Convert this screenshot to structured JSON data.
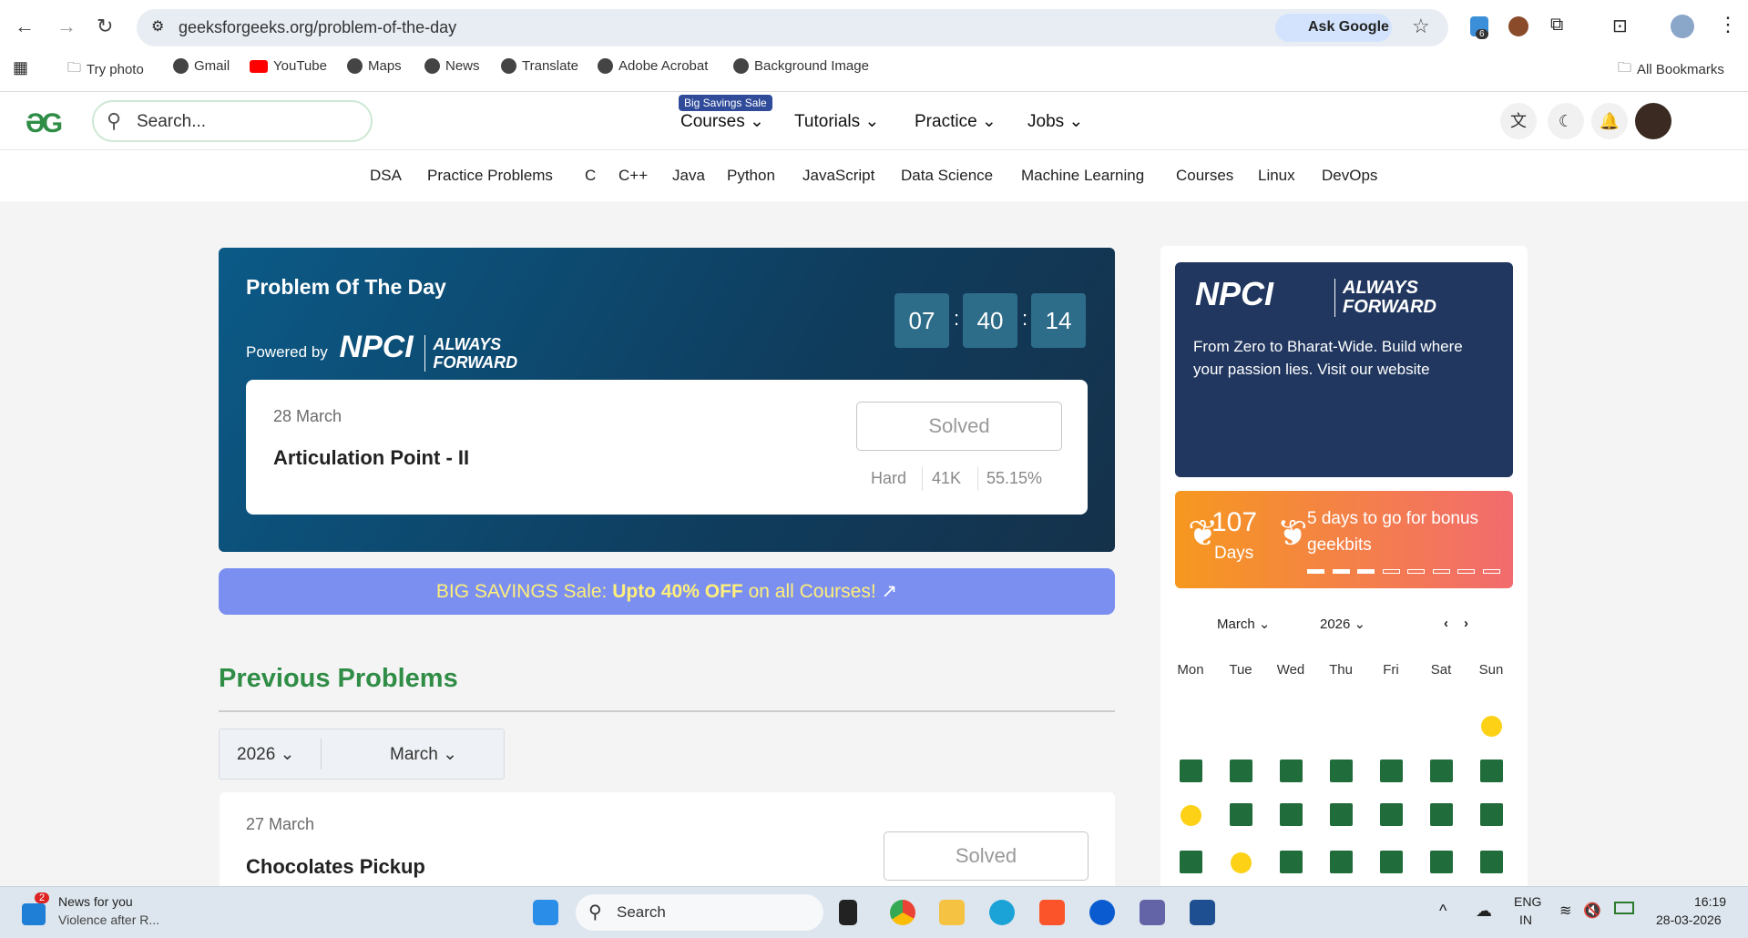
{
  "browser": {
    "url": "geeksforgeeks.org/problem-of-the-day",
    "ask_google": "Ask Google",
    "ext_badge": "6",
    "bookmarks": [
      "Try photo",
      "Gmail",
      "YouTube",
      "Maps",
      "News",
      "Translate",
      "Adobe Acrobat",
      "Background Image"
    ],
    "all_bookmarks": "All Bookmarks"
  },
  "header": {
    "search_placeholder": "Search...",
    "sale_badge": "Big Savings Sale",
    "menus": [
      "Courses",
      "Tutorials",
      "Practice",
      "Jobs"
    ]
  },
  "subnav": [
    "DSA",
    "Practice Problems",
    "C",
    "C++",
    "Java",
    "Python",
    "JavaScript",
    "Data Science",
    "Machine Learning",
    "Courses",
    "Linux",
    "DevOps"
  ],
  "potd": {
    "title": "Problem Of The Day",
    "powered_by": "Powered by",
    "sponsor": "NPCI",
    "tagline": "ALWAYS FORWARD",
    "timer": [
      "07",
      "40",
      "14"
    ],
    "date": "28 March",
    "problem": "Articulation Point - II",
    "status": "Solved",
    "difficulty": "Hard",
    "submissions": "41K",
    "accuracy": "55.15%"
  },
  "sale": {
    "prefix": "BIG SAVINGS Sale:",
    "bold": "Upto 40% OFF",
    "suffix": "on all Courses!"
  },
  "previous": {
    "heading": "Previous Problems",
    "year": "2026",
    "month": "March",
    "items": [
      {
        "date": "27 March",
        "title": "Chocolates Pickup",
        "status": "Solved"
      }
    ]
  },
  "sidebar": {
    "ad_text": "From Zero to Bharat-Wide. Build where your passion lies. Visit our website",
    "streak_count": "107",
    "streak_unit": "Days",
    "bonus_text": "5 days to go for bonus geekbits",
    "bonus_progress": "3/8",
    "calendar": {
      "month": "March",
      "year": "2026",
      "weekdays": [
        "Mon",
        "Tue",
        "Wed",
        "Thu",
        "Fri",
        "Sat",
        "Sun"
      ]
    }
  },
  "taskbar": {
    "news_title": "News for you",
    "news_sub": "Violence after R...",
    "news_badge": "2",
    "search": "Search",
    "lang1": "ENG",
    "lang2": "IN",
    "time": "16:19",
    "date": "28-03-2026"
  }
}
